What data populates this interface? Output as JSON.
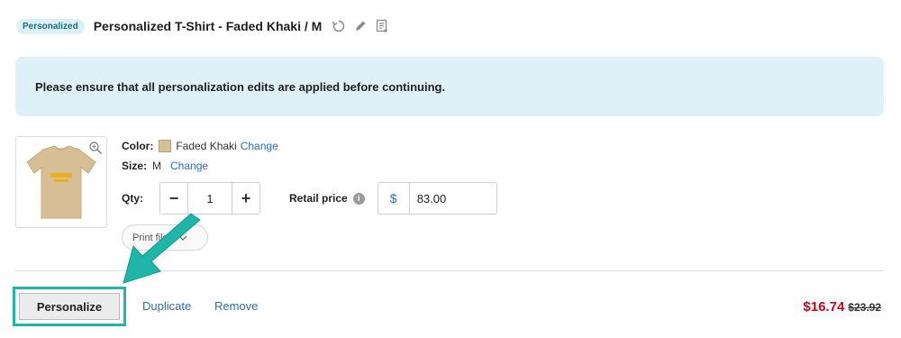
{
  "header": {
    "badge": "Personalized",
    "title": "Personalized T-Shirt - Faded Khaki / M",
    "icons": [
      "refresh-icon",
      "pencil-icon",
      "notes-icon"
    ]
  },
  "notice": {
    "text": "Please ensure that all personalization edits are applied before continuing."
  },
  "product": {
    "color_label": "Color:",
    "color_value": "Faded Khaki",
    "color_hex": "#d6bf94",
    "change_label": "Change",
    "size_label": "Size:",
    "size_value": "M",
    "qty_label": "Qty:",
    "qty_value": "1",
    "minus": "−",
    "plus": "+",
    "retail_label": "Retail price",
    "currency": "$",
    "retail_value": "83.00",
    "print_files_label": "Print files"
  },
  "actions": {
    "personalize": "Personalize",
    "duplicate": "Duplicate",
    "remove": "Remove"
  },
  "pricing": {
    "sale_price": "$16.74",
    "original_price": "$23.92"
  },
  "colors": {
    "accent": "#1fb6a9",
    "link": "#2c6db5",
    "sale": "#d0021b",
    "notice_bg": "#dff1f8"
  }
}
